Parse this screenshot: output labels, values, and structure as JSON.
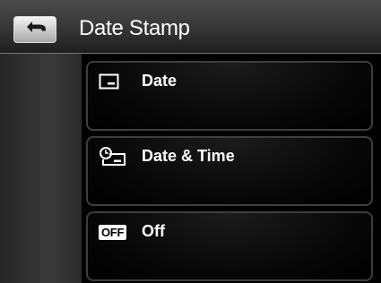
{
  "header": {
    "title": "Date Stamp",
    "back_icon": "back-arrow-icon"
  },
  "menu": {
    "items": [
      {
        "label": "Date",
        "icon": "date-stamp-icon"
      },
      {
        "label": "Date & Time",
        "icon": "date-time-stamp-icon"
      },
      {
        "label": "Off",
        "icon": "off-badge-icon",
        "icon_text": "OFF"
      }
    ]
  },
  "colors": {
    "header_bg": "#3a3a3a",
    "item_border": "#3e3e3e",
    "text": "#ffffff"
  }
}
